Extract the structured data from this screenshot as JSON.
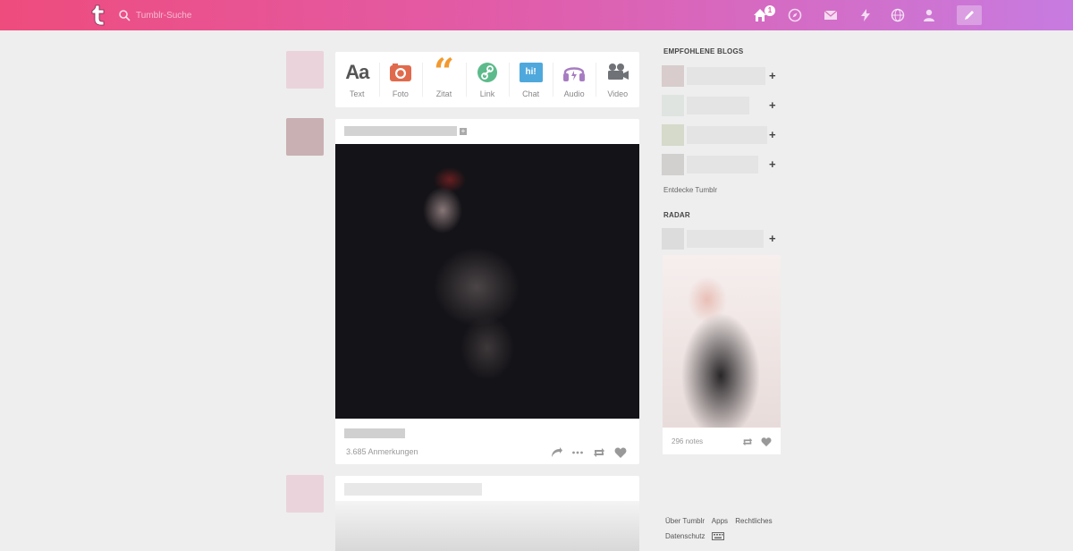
{
  "header": {
    "search_placeholder": "Tumblr-Suche",
    "home_badge": "1",
    "accent_start": "#ee4c7d",
    "accent_end": "#c77be0"
  },
  "post_types": [
    {
      "label": "Text",
      "icon": "text-icon"
    },
    {
      "label": "Foto",
      "icon": "camera-icon"
    },
    {
      "label": "Zitat",
      "icon": "quote-icon"
    },
    {
      "label": "Link",
      "icon": "link-icon"
    },
    {
      "label": "Chat",
      "icon": "chat-icon"
    },
    {
      "label": "Audio",
      "icon": "headphones-icon"
    },
    {
      "label": "Video",
      "icon": "video-camera-icon"
    }
  ],
  "text_icon_glyph": "Aa",
  "quote_icon_glyph": "“",
  "chat_icon_glyph": "hi!",
  "post": {
    "notes": "3.685 Anmerkungen"
  },
  "sidebar": {
    "recommended_title": "EMPFOHLENE BLOGS",
    "follow_symbol": "+",
    "discover_link": "Entdecke Tumblr",
    "radar_title": "RADAR",
    "radar_notes": "296 notes"
  },
  "footer": {
    "about": "Über Tumblr",
    "apps": "Apps",
    "legal": "Rechtliches",
    "privacy": "Datenschutz"
  }
}
